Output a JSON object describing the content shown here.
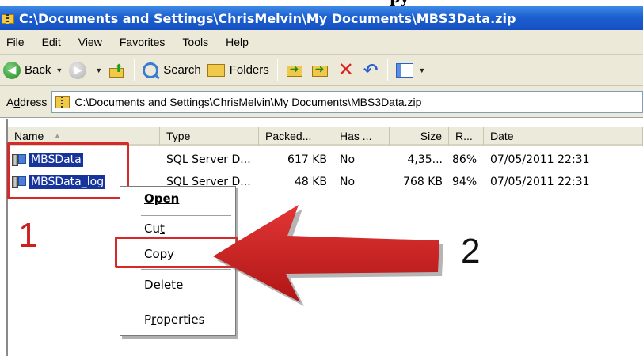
{
  "cropped_caption": "py",
  "window": {
    "title": "C:\\Documents and Settings\\ChrisMelvin\\My Documents\\MBS3Data.zip",
    "title_icon": "zip-folder-icon"
  },
  "menubar": {
    "items": [
      {
        "pre": "",
        "ul": "F",
        "post": "ile"
      },
      {
        "pre": "",
        "ul": "E",
        "post": "dit"
      },
      {
        "pre": "",
        "ul": "V",
        "post": "iew"
      },
      {
        "pre": "F",
        "ul": "a",
        "post": "vorites"
      },
      {
        "pre": "",
        "ul": "T",
        "post": "ools"
      },
      {
        "pre": "",
        "ul": "H",
        "post": "elp"
      }
    ]
  },
  "toolbar": {
    "back_label": "Back",
    "search_label": "Search",
    "folders_label": "Folders"
  },
  "addressbar": {
    "label_pre": "A",
    "label_ul": "d",
    "label_post": "dress",
    "path": "C:\\Documents and Settings\\ChrisMelvin\\My Documents\\MBS3Data.zip"
  },
  "list": {
    "headers": [
      "Name",
      "Type",
      "Packed...",
      "Has ...",
      "Size",
      "R...",
      "Date"
    ],
    "rows": [
      {
        "name": "MBSData",
        "type": "SQL Server D...",
        "packed": "617 KB",
        "has": "No",
        "size": "4,35...",
        "ratio": "86%",
        "date": "07/05/2011 22:31"
      },
      {
        "name": "MBSData_log",
        "type": "SQL Server D...",
        "packed": "48 KB",
        "has": "No",
        "size": "768 KB",
        "ratio": "94%",
        "date": "07/05/2011 22:31"
      }
    ]
  },
  "context_menu": {
    "open": "Open",
    "cut_pre": "Cu",
    "cut_ul": "t",
    "cut_post": "",
    "copy_pre": "",
    "copy_ul": "C",
    "copy_post": "opy",
    "delete_pre": "",
    "delete_ul": "D",
    "delete_post": "elete",
    "props_pre": "P",
    "props_ul": "r",
    "props_post": "operties"
  },
  "annotations": {
    "step1": "1",
    "step2": "2",
    "accent": "#d62a2a"
  }
}
